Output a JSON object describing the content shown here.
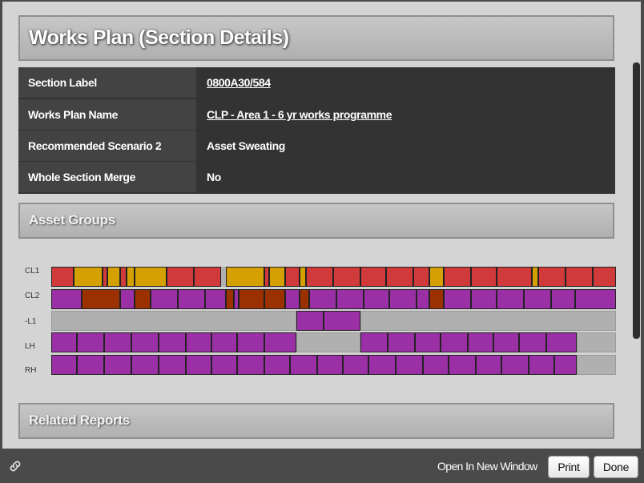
{
  "page_title": "Works Plan (Section Details)",
  "details": [
    {
      "label": "Section Label",
      "value": "0800A30/584",
      "link": true
    },
    {
      "label": "Works Plan Name",
      "value": "CLP - Area 1 - 6 yr works programme",
      "link": true
    },
    {
      "label": "Recommended Scenario 2",
      "value": "Asset Sweating",
      "link": false
    },
    {
      "label": "Whole Section Merge",
      "value": "No",
      "link": false
    }
  ],
  "asset_groups": {
    "title": "Asset Groups",
    "lanes": [
      {
        "name": "CL1"
      },
      {
        "name": "CL2"
      },
      {
        "name": "-L1"
      },
      {
        "name": "LH"
      },
      {
        "name": "RH"
      }
    ]
  },
  "related_reports": {
    "title": "Related Reports"
  },
  "footer": {
    "link_icon": "link-icon",
    "open_new_window": "Open In New Window",
    "print": "Print",
    "done": "Done"
  },
  "colors": {
    "red": "#d13a3a",
    "gold": "#d4a000",
    "purple": "#9b30a6",
    "brown": "#9b3000",
    "grey": "#b0b0b0"
  }
}
